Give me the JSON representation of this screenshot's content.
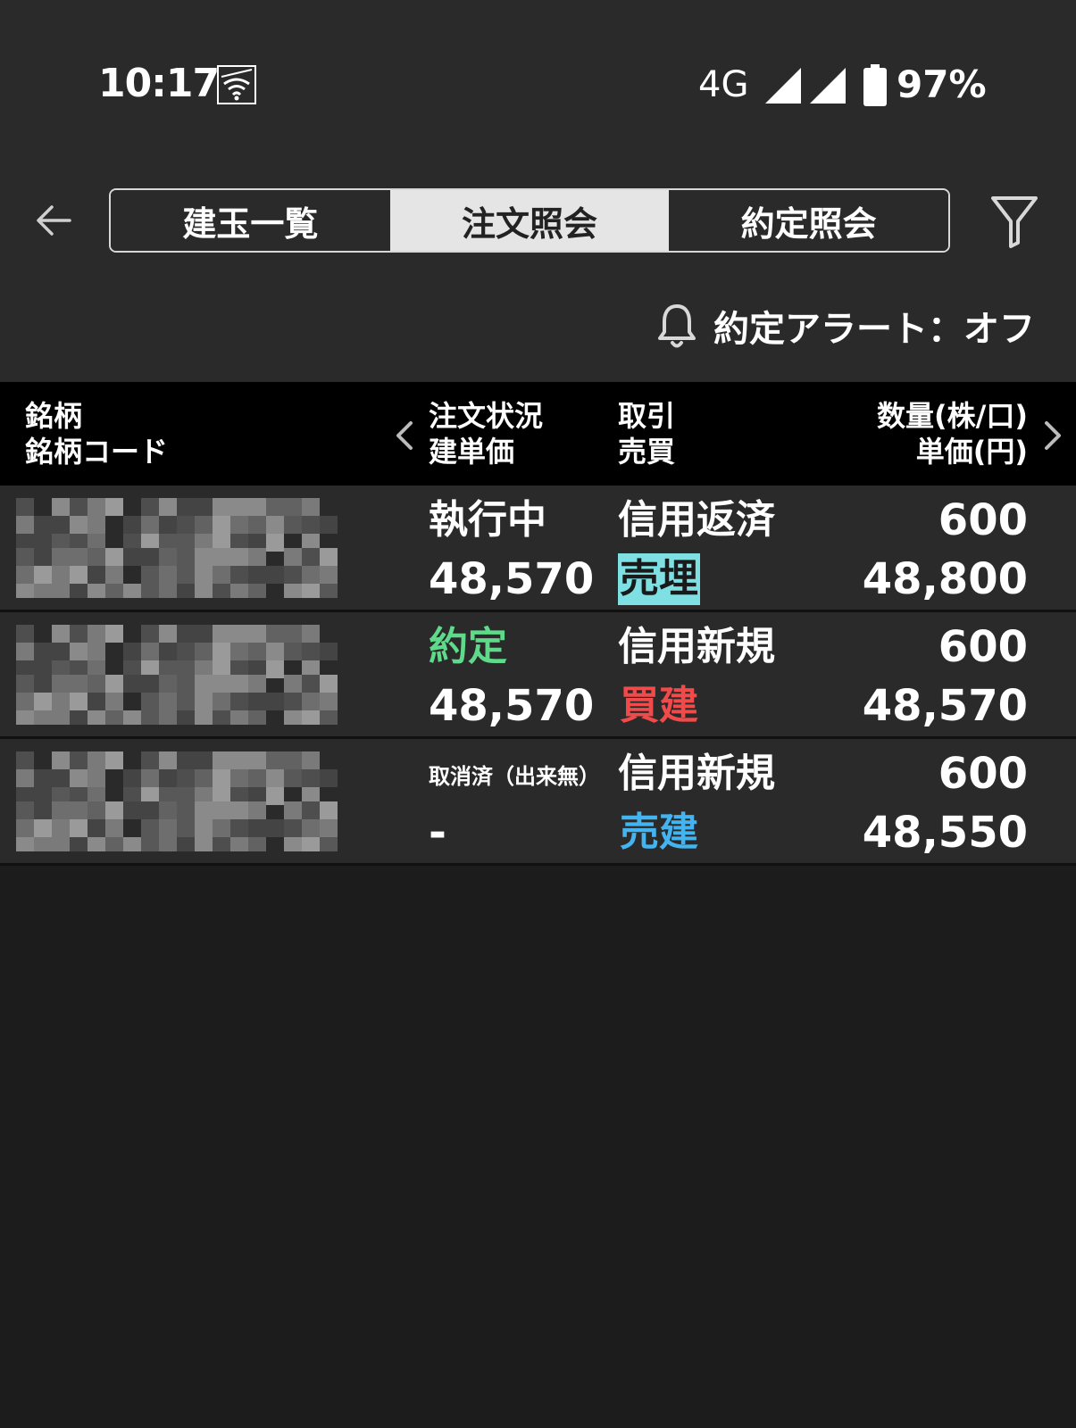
{
  "status_bar": {
    "time": "10:17",
    "network": "4G",
    "battery": "97%",
    "icons": [
      "au-wifi-icon",
      "signal-icon",
      "signal-icon",
      "battery-icon"
    ]
  },
  "tabs": [
    {
      "label": "建玉一覧",
      "active": false
    },
    {
      "label": "注文照会",
      "active": true
    },
    {
      "label": "約定照会",
      "active": false
    }
  ],
  "alert": {
    "label": "約定アラート：オフ",
    "icon": "bell-icon"
  },
  "table": {
    "headers": {
      "col1": [
        "銘柄",
        "銘柄コード"
      ],
      "col2": [
        "注文状況",
        "建単価"
      ],
      "col3": [
        "取引",
        "売買"
      ],
      "col4": [
        "数量(株/口)",
        "単価(円)"
      ]
    },
    "rows": [
      {
        "status": "執行中",
        "price": "48,570",
        "trade": "信用返済",
        "side": "売埋",
        "qty": "600",
        "unit_price": "48,800"
      },
      {
        "status": "約定",
        "price": "48,570",
        "trade": "信用新規",
        "side": "買建",
        "qty": "600",
        "unit_price": "48,570"
      },
      {
        "status": "取消済（出来無）",
        "price": "-",
        "trade": "信用新規",
        "side": "売建",
        "qty": "600",
        "unit_price": "48,550"
      }
    ]
  },
  "colors": {
    "status_done": "#5fd98a",
    "buy": "#f04a4a",
    "sell": "#43b4f0",
    "settle_sell_bg": "#7fe0e4",
    "settle_sell_text": "#1a1a1a",
    "header_bg": "#000000",
    "row_bg": "#2a2a2a"
  }
}
